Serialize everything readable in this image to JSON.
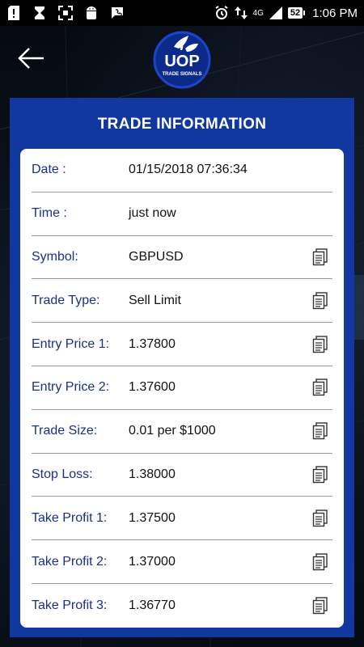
{
  "status_bar": {
    "battery": "52",
    "time": "1:06 PM",
    "network": "4G"
  },
  "header": {
    "back_icon": "arrow-left-icon",
    "logo_text": "UOP",
    "logo_subtext": "TRADE SIGNALS"
  },
  "panel": {
    "title": "TRADE INFORMATION"
  },
  "rows": [
    {
      "label": "Date :",
      "value": "01/15/2018 07:36:34",
      "copy": false
    },
    {
      "label": "Time :",
      "value": "just now",
      "copy": false
    },
    {
      "label": "Symbol:",
      "value": "GBPUSD",
      "copy": true
    },
    {
      "label": "Trade Type:",
      "value": "Sell Limit",
      "copy": true
    },
    {
      "label": "Entry Price 1:",
      "value": "1.37800",
      "copy": true
    },
    {
      "label": "Entry Price 2:",
      "value": "1.37600",
      "copy": true
    },
    {
      "label": "Trade Size:",
      "value": "0.01 per $1000",
      "copy": true
    },
    {
      "label": "Stop Loss:",
      "value": "1.38000",
      "copy": true
    },
    {
      "label": "Take Profit 1:",
      "value": "1.37500",
      "copy": true
    },
    {
      "label": "Take Profit 2:",
      "value": "1.37000",
      "copy": true
    },
    {
      "label": "Take Profit 3:",
      "value": "1.36770",
      "copy": true
    }
  ],
  "colors": {
    "panel": "#1238a0",
    "label": "#1a2f8a",
    "background": "#0a0f1a"
  }
}
